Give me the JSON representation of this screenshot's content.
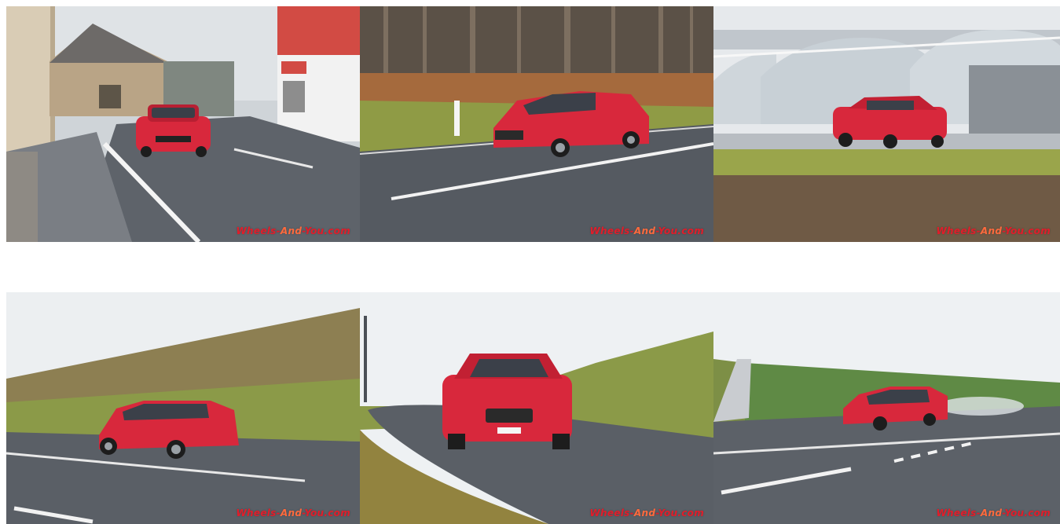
{
  "gallery": {
    "watermark": {
      "part1": "Wheels-",
      "part2": "And",
      "part3": "-You.com"
    },
    "colors": {
      "car_red": "#d8283c",
      "watermark_red": "#e11d2a",
      "sky": "#e9ecef",
      "road": "#5a5f66",
      "grass": "#8a9a3a"
    },
    "photos": [
      {
        "subject": "red-hatchback-wagon-village-road"
      },
      {
        "subject": "red-hatchback-wagon-forest-road"
      },
      {
        "subject": "red-hatchback-wagon-greenhouses"
      },
      {
        "subject": "red-hatchback-wagon-side-view-hill"
      },
      {
        "subject": "red-hatchback-wagon-front-view-curve"
      },
      {
        "subject": "red-hatchback-wagon-wet-road-field"
      }
    ]
  }
}
